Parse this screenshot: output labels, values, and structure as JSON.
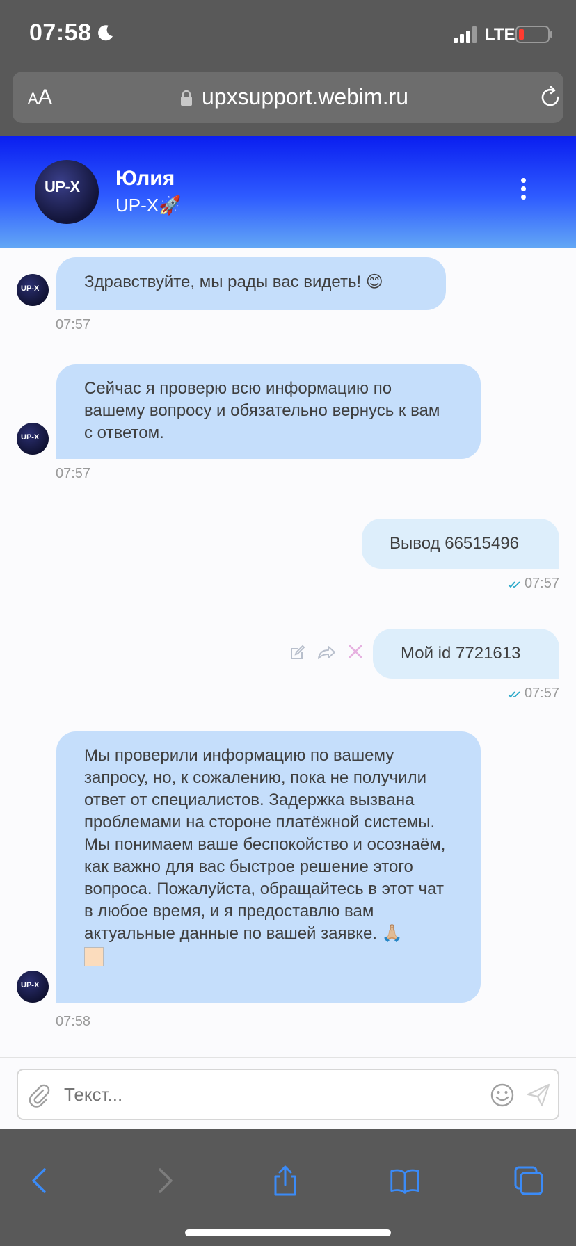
{
  "status": {
    "time": "07:58",
    "network": "LTE"
  },
  "browser": {
    "text_size_label_small": "A",
    "text_size_label_large": "A",
    "url": "upxsupport.webim.ru"
  },
  "header": {
    "name": "Юлия",
    "subtitle": "UP-X🚀",
    "avatar_logo": "UP-X"
  },
  "messages": [
    {
      "side": "operator",
      "text": "Здравствуйте, мы рады вас видеть! 😊",
      "time": "07:57"
    },
    {
      "side": "operator",
      "text": "Сейчас я проверю всю информацию по вашему вопросу и обязательно вернусь к вам с ответом.",
      "time": "07:57"
    },
    {
      "side": "user",
      "text": "Вывод 66515496",
      "time": "07:57"
    },
    {
      "side": "user",
      "text": "Мой id 7721613",
      "time": "07:57"
    },
    {
      "side": "operator",
      "text": "Мы проверили информацию по вашему запросу, но, к сожалению, пока не получили ответ от специалистов. Задержка вызвана проблемами на стороне платёжной системы. Мы понимаем ваше беспокойство и осознаём, как важно для вас быстрое решение этого вопроса. Пожалуйста, обращайтесь в этот чат в любое время, и я предоставлю вам актуальные данные по вашей заявке. 🙏🏼",
      "time": "07:58"
    }
  ],
  "input": {
    "placeholder": "Текст..."
  },
  "colors": {
    "operator_bubble": "#c5defb",
    "user_bubble": "#ddeefb",
    "header_gradient_top": "#0a1ef0",
    "header_gradient_bottom": "#62a6f5",
    "read_ticks": "#2aa9c9"
  },
  "icons": [
    "moon-icon",
    "signal-icon",
    "battery-icon",
    "lock-icon",
    "reload-icon",
    "more-icon",
    "edit-icon",
    "forward-icon",
    "delete-icon",
    "read-ticks-icon",
    "paperclip-icon",
    "emoji-icon",
    "send-icon",
    "back-icon",
    "forward-nav-icon",
    "share-icon",
    "bookmarks-icon",
    "tabs-icon"
  ]
}
